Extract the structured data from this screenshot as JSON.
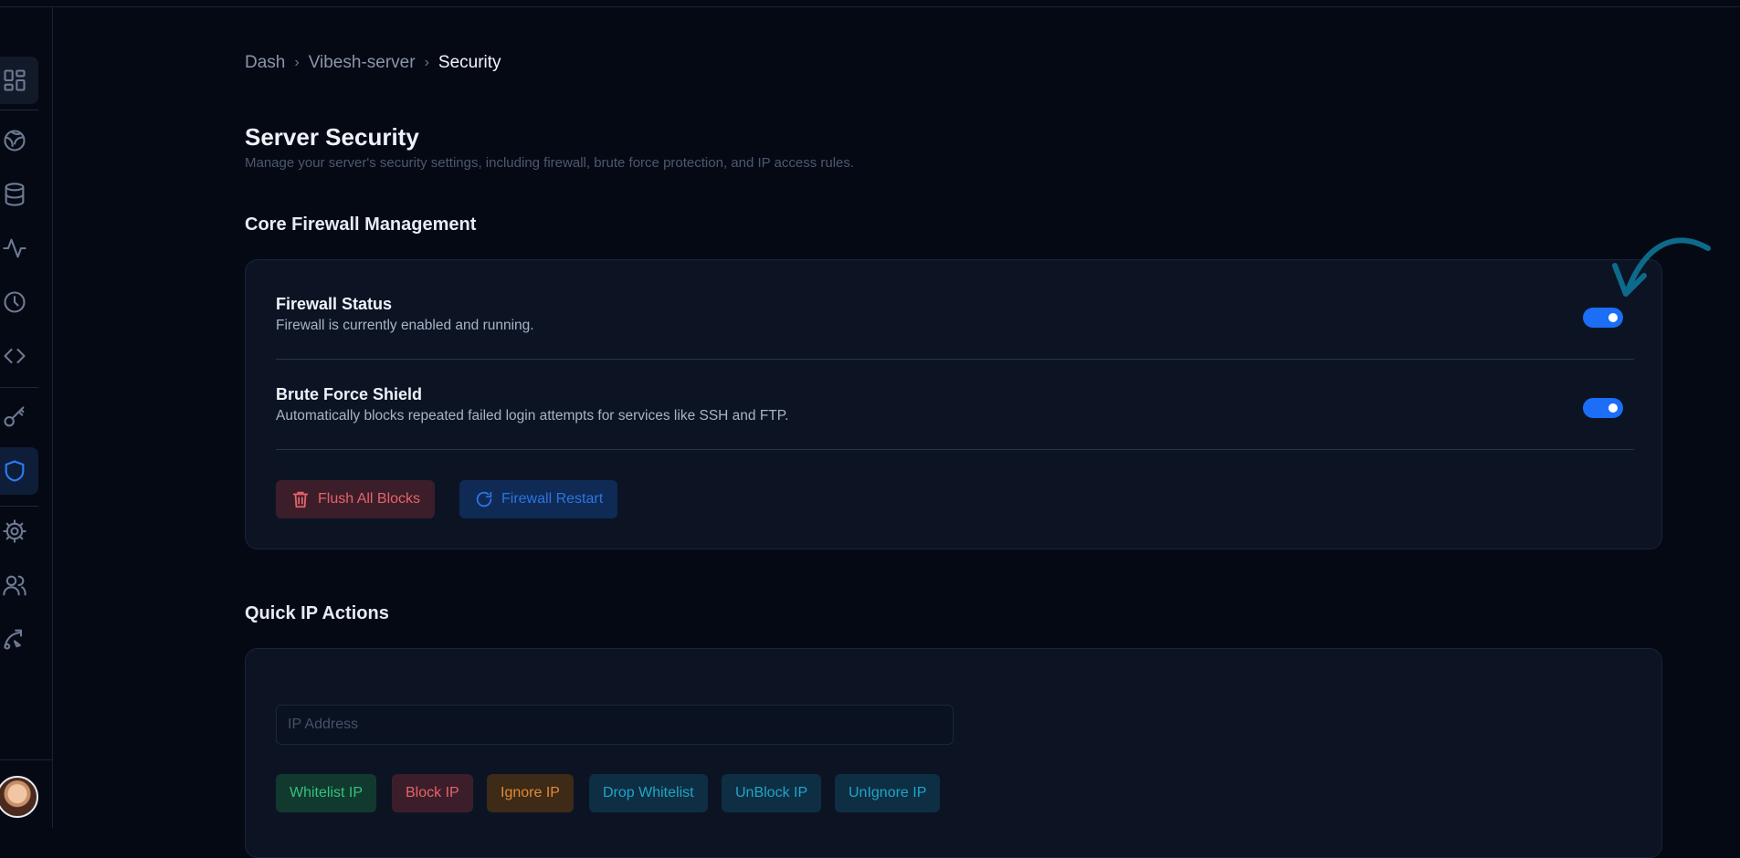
{
  "breadcrumb": {
    "items": [
      "Dash",
      "Vibesh-server",
      "Security"
    ],
    "separator": ">"
  },
  "page": {
    "title": "Server Security",
    "subtitle": "Manage your server's security settings, including firewall, brute force protection, and IP access rules."
  },
  "firewall_section": {
    "title": "Core Firewall Management",
    "rows": [
      {
        "title": "Firewall Status",
        "description": "Firewall is currently enabled and running.",
        "enabled": true
      },
      {
        "title": "Brute Force Shield",
        "description": "Automatically blocks repeated failed login attempts for services like SSH and FTP.",
        "enabled": true
      }
    ],
    "buttons": {
      "flush": "Flush All Blocks",
      "restart": "Firewall Restart"
    }
  },
  "ip_section": {
    "title": "Quick IP Actions",
    "input_placeholder": "IP Address",
    "input_value": "",
    "actions": [
      "Whitelist IP",
      "Block IP",
      "Ignore IP",
      "Drop Whitelist",
      "UnBlock IP",
      "UnIgnore IP"
    ]
  },
  "sidebar": {
    "icons": [
      "dashboard-icon",
      "globe-icon",
      "database-icon",
      "activity-icon",
      "clock-icon",
      "code-icon",
      "key-icon",
      "shield-icon",
      "settings-icon",
      "users-icon",
      "deploy-icon"
    ],
    "active": "shield-icon"
  },
  "colors": {
    "accent": "#1b6ef5",
    "danger": "#e5636a",
    "success": "#34c17c",
    "warning": "#e38a37",
    "info": "#1fa6c4",
    "annotation_arrow": "#0e6a8a"
  }
}
